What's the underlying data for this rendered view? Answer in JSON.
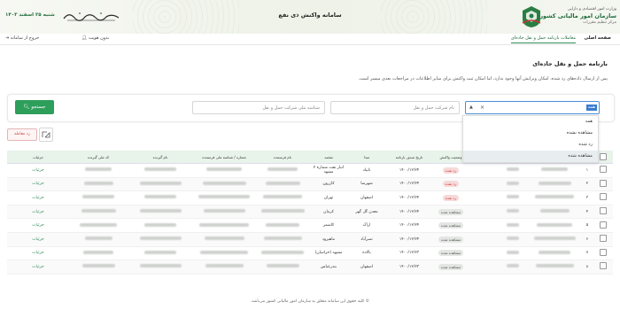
{
  "header": {
    "org_line1": "وزارت امور اقتصادی و دارایی",
    "org_line2": "سازمان امور مالیاتی کشور",
    "org_line3": "مرکز تنظیم مقررات",
    "system_name": "سامانه واکنش ذی نفع",
    "date": "شنبه ۲۵ اسفند ۱۴۰۳",
    "calligraphy_icon": "basmala-calligraphy"
  },
  "nav": {
    "home": "صفحه اصلی",
    "active": "معاملات بارنامه حمل و نقل جاده‌ای",
    "user": "بدون هویت",
    "logout": "خروج از سامانه"
  },
  "page": {
    "title": "بارنامه حمل و نقل جاده‌ای",
    "description": "پس از ارسال داده‌های رد شده، امکان ویرایش آنها وجود ندارد، اما امکان ثبت واکنش برای سایر اطلاعات در مراجعات بعدی میسر است."
  },
  "search": {
    "select_value": "همه",
    "company_placeholder": "نام شرکت حمل و نقل",
    "national_id_placeholder": "شناسه ملی شرکت حمل و نقل",
    "search_button": "جستجو"
  },
  "dropdown": {
    "options": [
      "همه",
      "مشاهده نشده",
      "رد شده",
      "مشاهده شده"
    ],
    "highlighted_index": 3
  },
  "actions": {
    "reject_button": "رد معامله",
    "edit_icon": "edit-icon"
  },
  "table": {
    "headers": [
      "",
      "",
      "",
      "",
      "وضعیت",
      "وضعیت واکنش",
      "تاریخ صدور بارنامه",
      "مبدا",
      "مقصد",
      "نام فرستنده",
      "شماره / شناسه ملی فرستنده",
      "نام گیرنده",
      "کد ملی گیرنده",
      "جزئیات"
    ],
    "rows": [
      {
        "no": "۱",
        "status": "",
        "reaction": "رد شده",
        "reaction_type": "rej",
        "date": "۱۴۰۰/۱۲/۲۴",
        "origin": "تایباد",
        "dest": "انبار نفت شماره ۲ مشهد",
        "detail": "جزئیات"
      },
      {
        "no": "۲",
        "status": "",
        "reaction": "رد شده",
        "reaction_type": "rej",
        "date": "۱۴۰۰/۱۲/۲۴",
        "origin": "شهرضا",
        "dest": "کازرون",
        "detail": "جزئیات"
      },
      {
        "no": "۳",
        "status": "",
        "reaction": "رد شده",
        "reaction_type": "rej",
        "date": "۱۴۰۰/۱۲/۲۴",
        "origin": "اصفهان",
        "dest": "تهران",
        "detail": "جزئیات"
      },
      {
        "no": "۴",
        "status": "",
        "reaction": "مشاهده شده",
        "reaction_type": "seen",
        "date": "۱۴۰۰/۱۲/۲۴",
        "origin": "معدن گل گهر",
        "dest": "کرمان",
        "detail": "جزئیات"
      },
      {
        "no": "۵",
        "status": "",
        "reaction": "مشاهده شده",
        "reaction_type": "seen",
        "date": "۱۴۰۰/۱۲/۲۴",
        "origin": "اراک",
        "dest": "کاشمر",
        "detail": "جزئیات"
      },
      {
        "no": "۶",
        "status": "",
        "reaction": "مشاهده شده",
        "reaction_type": "seen",
        "date": "۱۴۰۰/۱۲/۲۴",
        "origin": "نصرآباد",
        "dest": "ماهیرود",
        "detail": "جزئیات"
      },
      {
        "no": "۷",
        "status": "",
        "reaction": "مشاهده شده",
        "reaction_type": "seen",
        "date": "۱۴۰۰/۱۲/۲۳",
        "origin": "بالاده",
        "dest": "مشهد (خراسان)",
        "detail": "جزئیات"
      },
      {
        "no": "۸",
        "status": "",
        "reaction": "مشاهده شده",
        "reaction_type": "seen",
        "date": "۱۴۰۰/۱۲/۲۳",
        "origin": "اصفهان",
        "dest": "بندرعباس",
        "detail": "جزئیات"
      }
    ]
  },
  "footer": "© کلیه حقوق این سامانه متعلق به سازمان امور مالیاتی کشور می‌باشد.",
  "colors": {
    "primary": "#2e9e5b",
    "header_bg": "#eef2e8",
    "reject": "#c33",
    "table_head": "#e8f3ea"
  }
}
